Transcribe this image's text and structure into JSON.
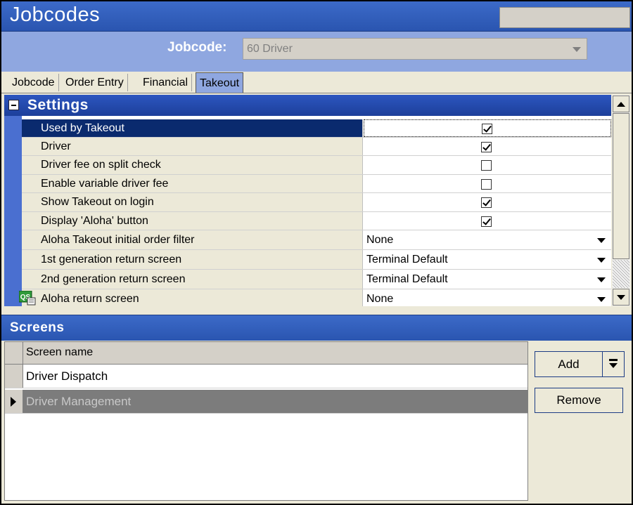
{
  "window": {
    "title": "Jobcodes"
  },
  "jobcode": {
    "label": "Jobcode:",
    "value": "60 Driver"
  },
  "tabs": [
    {
      "label": "Jobcode"
    },
    {
      "label": "Order Entry"
    },
    {
      "label": "Financial"
    },
    {
      "label": "Takeout",
      "active": true
    }
  ],
  "settings": {
    "header": "Settings",
    "rows": [
      {
        "label": "Used by Takeout",
        "type": "checkbox",
        "checked": true,
        "selected": true
      },
      {
        "label": "Driver",
        "type": "checkbox",
        "checked": true
      },
      {
        "label": "Driver fee on split check",
        "type": "checkbox",
        "checked": false
      },
      {
        "label": "Enable variable driver fee",
        "type": "checkbox",
        "checked": false
      },
      {
        "label": "Show Takeout on login",
        "type": "checkbox",
        "checked": true
      },
      {
        "label": "Display 'Aloha' button",
        "type": "checkbox",
        "checked": true
      },
      {
        "label": "Aloha Takeout initial order filter",
        "type": "dropdown",
        "value": "None"
      },
      {
        "label": "1st generation return screen",
        "type": "dropdown",
        "value": "Terminal Default"
      },
      {
        "label": "2nd generation return screen",
        "type": "dropdown",
        "value": "Terminal Default"
      },
      {
        "label": "Aloha return screen",
        "type": "dropdown",
        "value": "None",
        "icon": "qs-icon",
        "icon_text": "QS"
      }
    ]
  },
  "screens": {
    "header": "Screens",
    "column": "Screen name",
    "rows": [
      {
        "name": "Driver Dispatch"
      },
      {
        "name": "Driver Management",
        "selected": true
      }
    ],
    "add_label": "Add",
    "remove_label": "Remove"
  },
  "colors": {
    "title_blue": "#2a55b0",
    "band_blue": "#8fa7e0",
    "selected_row": "#0a2a6e"
  }
}
